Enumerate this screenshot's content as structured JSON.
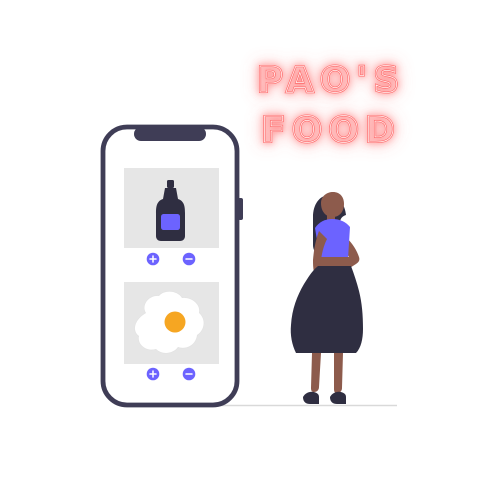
{
  "branding": {
    "logo_text": "PAO'S FOOD"
  },
  "colors": {
    "neon_outer_glow": "#ff6b6b",
    "neon_inner": "#fff0f0",
    "phone_stroke": "#3f3d56",
    "tile_bg": "#e6e6e6",
    "accent_purple": "#6c63ff",
    "skin": "#8d5b4c",
    "hair": "#2f2e41",
    "dress": "#2f2e41",
    "egg_yolk": "#f6a623"
  },
  "phone": {
    "items": [
      {
        "name": "ketchup-bottle",
        "actions": [
          "add",
          "remove"
        ]
      },
      {
        "name": "fried-egg",
        "actions": [
          "add",
          "remove"
        ]
      }
    ]
  }
}
